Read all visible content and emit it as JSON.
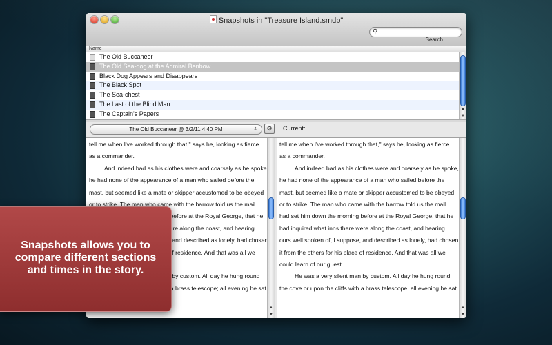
{
  "window": {
    "title": "Snapshots in \"Treasure Island.smdb\"",
    "search": {
      "value": "",
      "placeholder": "",
      "label": "Search"
    }
  },
  "list": {
    "column_header": "Name",
    "items": [
      {
        "label": "The Old Buccaneer",
        "icon": "document-icon"
      },
      {
        "label": "The Old Sea-dog at the Admiral Benbow",
        "icon": "document-icon"
      },
      {
        "label": "Black Dog Appears and Disappears",
        "icon": "document-icon"
      },
      {
        "label": "The Black Spot",
        "icon": "document-icon"
      },
      {
        "label": "The Sea-chest",
        "icon": "document-icon"
      },
      {
        "label": "The Last of the Blind Man",
        "icon": "document-icon"
      },
      {
        "label": "The Captain's Papers",
        "icon": "document-icon"
      }
    ],
    "selected_index": 1
  },
  "compare": {
    "snapshot_popup": "The Old Buccaneer @ 3/2/11 4:40 PM",
    "current_label": "Current:"
  },
  "left_text": [
    "tell me when I've worked through that,\" says he, looking as fierce",
    "as a commander.",
    "And indeed bad as his clothes were and coarsely as he spoke,",
    "he had none of the appearance of a man who sailed before the",
    "mast, but seemed like a mate or skipper accustomed to be obeyed",
    "or to strike. The man who came with the barrow told us the mail",
    "had set him down the morning before at the Royal George, that he",
    "had inquired what inns there were along the coast, and hearing",
    "ours well spoken of, I suppose, and described as lonely, had chosen",
    "it from the others for his place of residence. And that was all we",
    "could learn of our guest.",
    "He was a very silent man by custom. All day he hung round",
    "the cove or upon the cliffs with a brass telescope; all evening he sat"
  ],
  "right_text": [
    "tell me when I've worked through that,\" says he, looking as fierce",
    "as a commander.",
    "And indeed bad as his clothes were and coarsely as he spoke,",
    "he had none of the appearance of a man who sailed before the",
    "mast, but seemed like a mate or skipper accustomed to be obeyed",
    "or to strike. The man who came with the barrow told us the mail",
    "had set him down the morning before at the Royal George, that he",
    "had inquired what inns there were along the coast, and hearing",
    "ours well spoken of, I suppose, and described as lonely, had chosen",
    "it from the others for his place of residence. And that was all we",
    "could learn of our guest.",
    "He was a very silent man by custom. All day he hung round",
    "the cove or upon the cliffs with a brass telescope; all evening he sat"
  ],
  "indented_lines": [
    2,
    11
  ],
  "callout": {
    "text": "Snapshots allows you to\ncompare different sections\nand times in the story."
  },
  "colors": {
    "selection": "#c4c4c4",
    "alt_row": "#edf3fe",
    "callout_bg": "#a03c3c",
    "scroll_thumb": "#5a97e8"
  }
}
